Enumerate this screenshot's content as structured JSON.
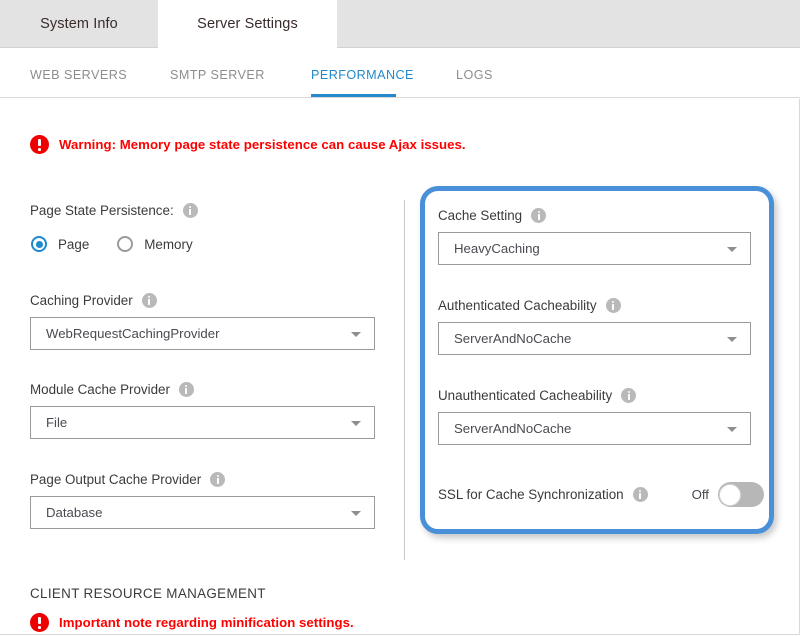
{
  "primary_tabs": [
    {
      "label": "System Info",
      "active": false
    },
    {
      "label": "Server Settings",
      "active": true
    }
  ],
  "sub_tabs": [
    {
      "label": "WEB SERVERS",
      "active": false
    },
    {
      "label": "SMTP SERVER",
      "active": false
    },
    {
      "label": "PERFORMANCE",
      "active": true
    },
    {
      "label": "LOGS",
      "active": false
    }
  ],
  "alerts": {
    "warning": {
      "icon": "error-exclamation-icon",
      "text": "Warning: Memory page state persistence can cause Ajax issues."
    },
    "minification": {
      "icon": "error-exclamation-icon",
      "text": "Important note regarding minification settings."
    }
  },
  "left_column": {
    "page_state_persistence": {
      "label": "Page State Persistence:",
      "info_icon": "info-icon",
      "options": [
        {
          "label": "Page",
          "selected": true
        },
        {
          "label": "Memory",
          "selected": false
        }
      ]
    },
    "caching_provider": {
      "label": "Caching Provider",
      "info_icon": "info-icon",
      "value": "WebRequestCachingProvider"
    },
    "module_cache_provider": {
      "label": "Module Cache Provider",
      "info_icon": "info-icon",
      "value": "File"
    },
    "page_output_cache_provider": {
      "label": "Page Output Cache Provider",
      "info_icon": "info-icon",
      "value": "Database"
    }
  },
  "right_column": {
    "cache_setting": {
      "label": "Cache Setting",
      "info_icon": "info-icon",
      "value": "HeavyCaching"
    },
    "authenticated_cacheability": {
      "label": "Authenticated Cacheability",
      "info_icon": "info-icon",
      "value": "ServerAndNoCache"
    },
    "unauthenticated_cacheability": {
      "label": "Unauthenticated Cacheability",
      "info_icon": "info-icon",
      "value": "ServerAndNoCache"
    },
    "ssl_cache_sync": {
      "label": "SSL for Cache Synchronization",
      "info_icon": "info-icon",
      "state": "Off",
      "on": false
    }
  },
  "bottom_section": {
    "heading": "CLIENT RESOURCE MANAGEMENT"
  },
  "colors": {
    "accent_blue": "#2389ca",
    "highlight_border": "#4a90d9",
    "alert_red": "#ff0000",
    "tabstrip_grey": "#e3e3e3"
  }
}
